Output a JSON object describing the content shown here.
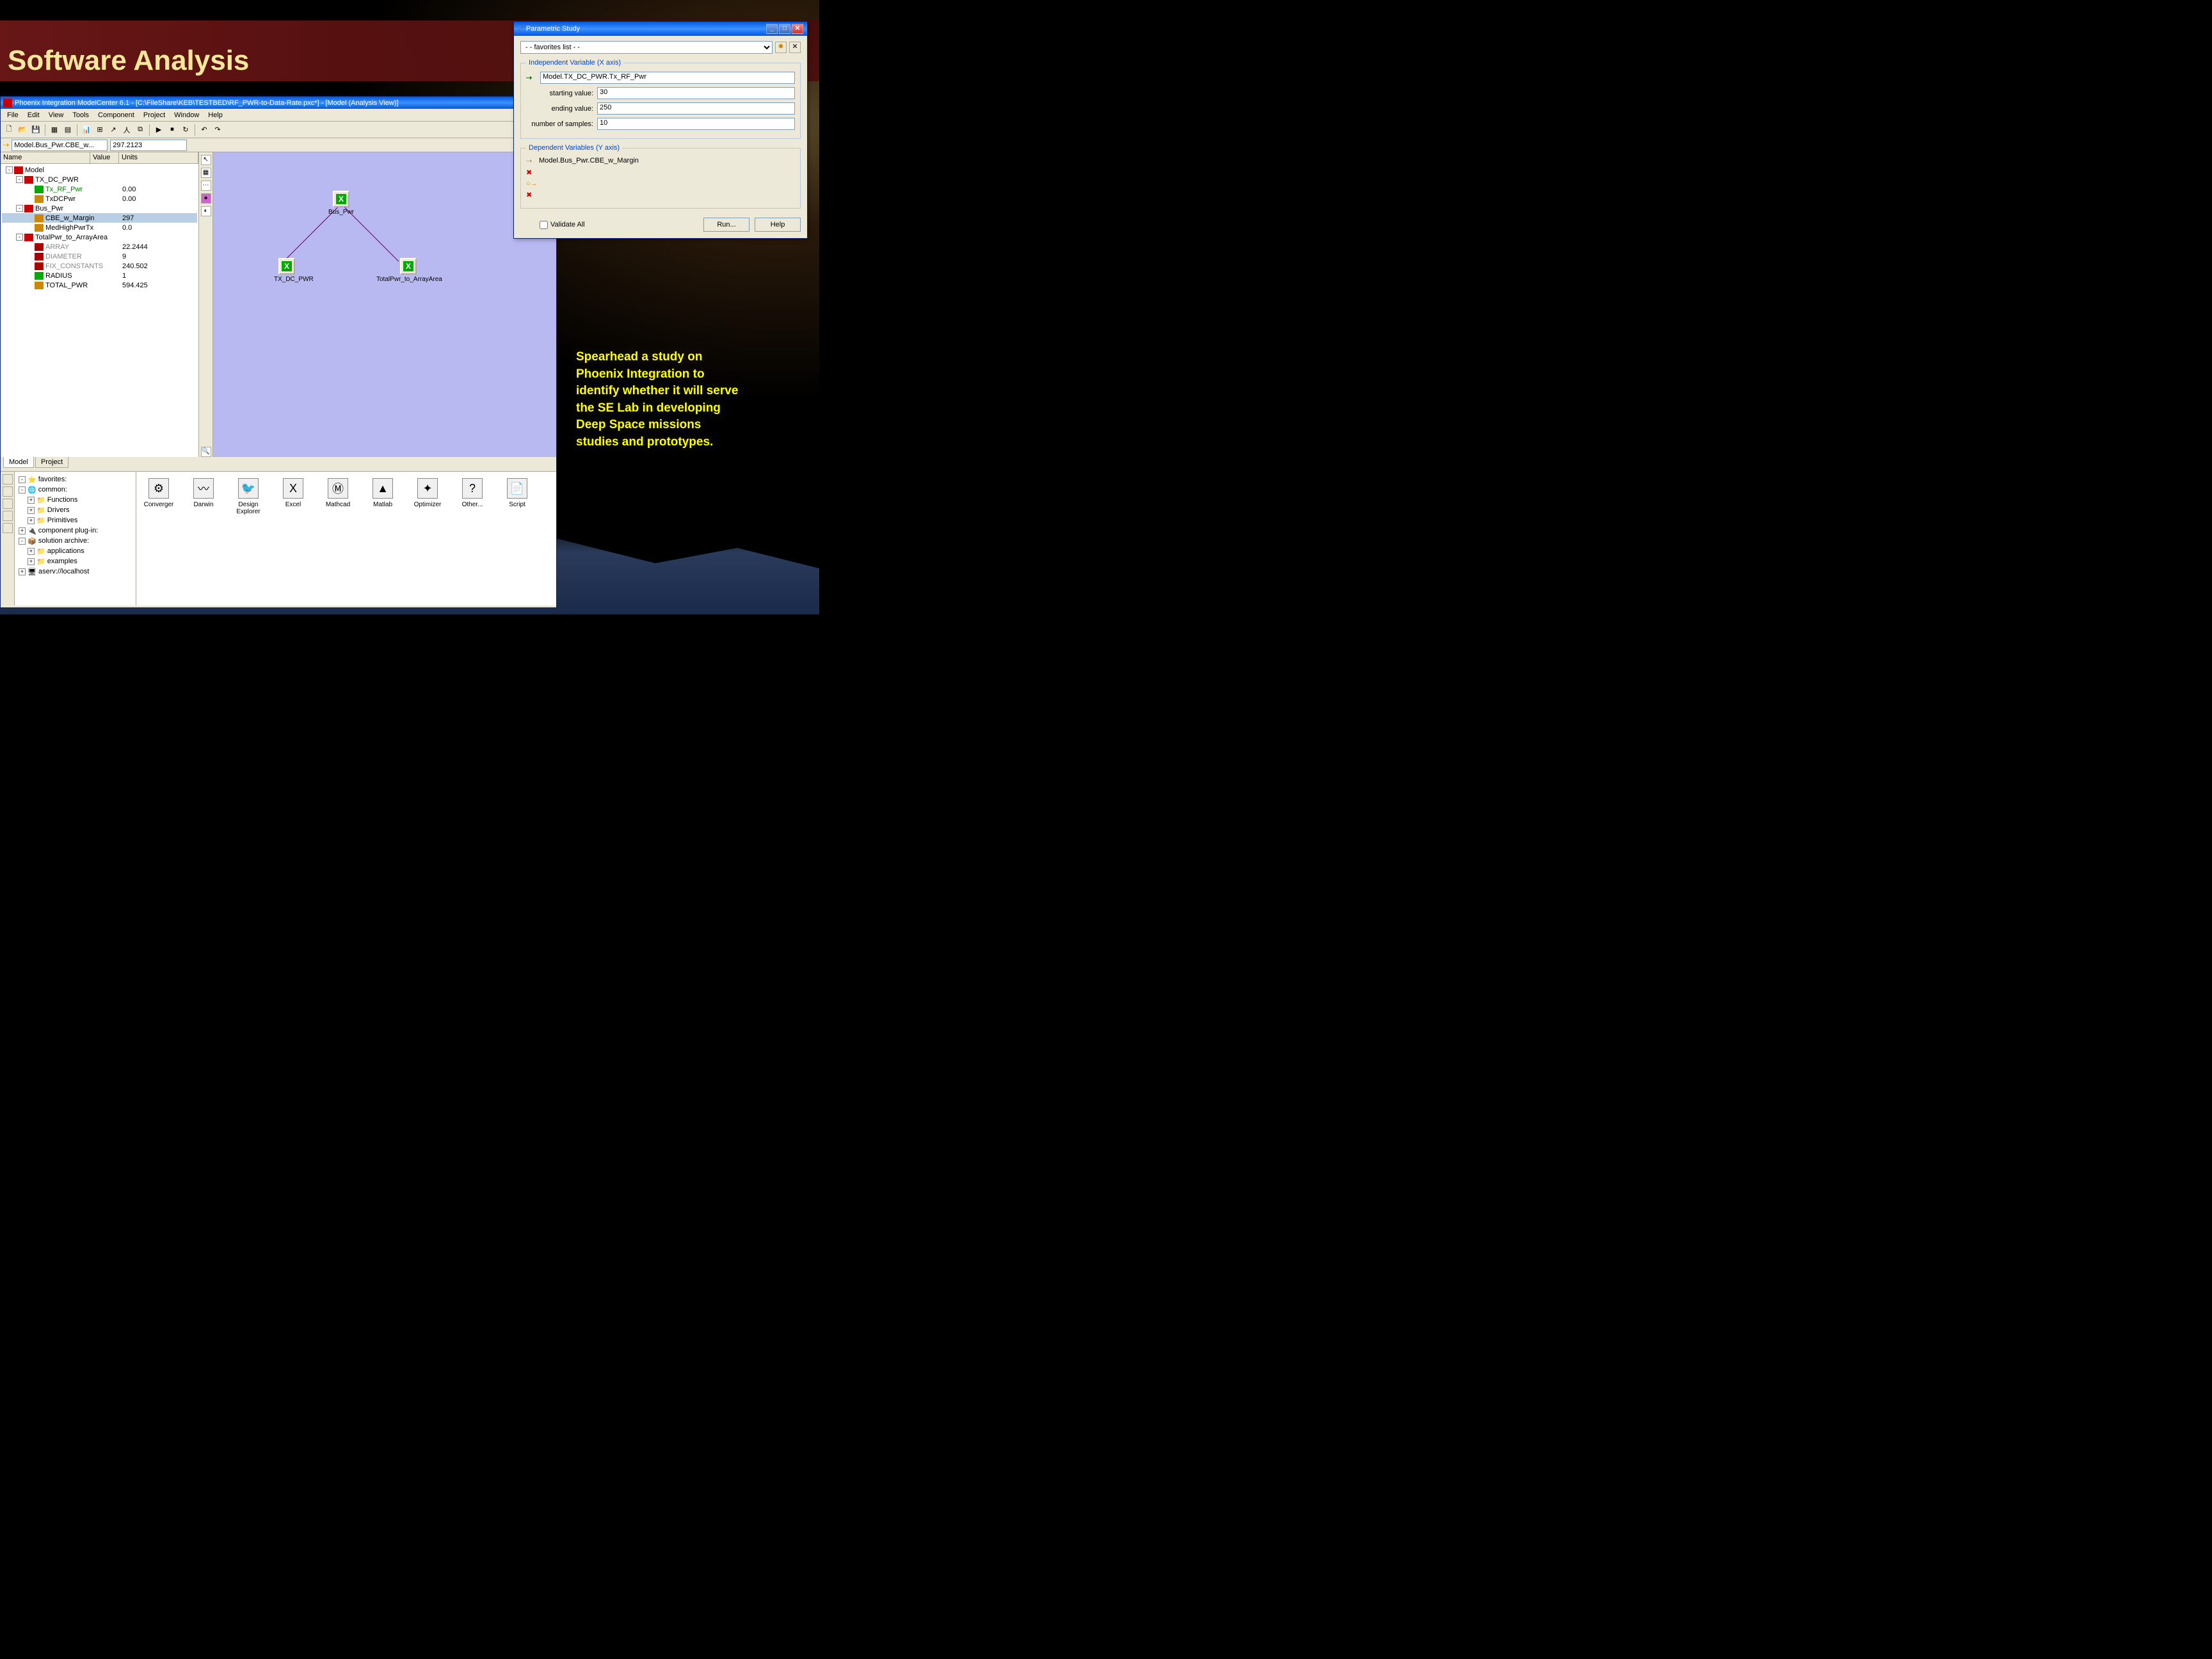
{
  "slide": {
    "title": "Software Analysis",
    "caption": "Spearhead a study on Phoenix Integration to identify whether it will serve the SE Lab in developing Deep Space missions studies and prototypes."
  },
  "mc": {
    "title": "Phoenix Integration ModelCenter 6.1 - [C:\\FileShare\\KEB\\TESTBED\\RF_PWR-to-Data-Rate.pxc*] - [Model (Analysis View)]",
    "menu": [
      "File",
      "Edit",
      "View",
      "Tools",
      "Component",
      "Project",
      "Window",
      "Help"
    ],
    "path_field": "Model.Bus_Pwr.CBE_w...",
    "path_value": "297.2123",
    "tree_headers": {
      "name": "Name",
      "value": "Value",
      "units": "Units"
    },
    "tree": [
      {
        "indent": 0,
        "exp": "-",
        "icon": "#c00",
        "name": "Model",
        "val": ""
      },
      {
        "indent": 1,
        "exp": "-",
        "icon": "#c00",
        "name": "TX_DC_PWR",
        "val": ""
      },
      {
        "indent": 2,
        "exp": "",
        "icon": "#0a0",
        "name": "Tx_RF_Pwr",
        "val": "0.00",
        "cls": "green"
      },
      {
        "indent": 2,
        "exp": "",
        "icon": "#c80",
        "name": "TxDCPwr",
        "val": "0.00"
      },
      {
        "indent": 1,
        "exp": "-",
        "icon": "#c00",
        "name": "Bus_Pwr",
        "val": ""
      },
      {
        "indent": 2,
        "exp": "",
        "icon": "#c80",
        "name": "CBE_w_Margin",
        "val": "297",
        "sel": true
      },
      {
        "indent": 2,
        "exp": "",
        "icon": "#c80",
        "name": "MedHighPwrTx",
        "val": "0.0"
      },
      {
        "indent": 1,
        "exp": "-",
        "icon": "#c00",
        "name": "TotalPwr_to_ArrayArea",
        "val": ""
      },
      {
        "indent": 2,
        "exp": "",
        "icon": "#a00",
        "name": "ARRAY",
        "val": "22.2444",
        "cls": "gray"
      },
      {
        "indent": 2,
        "exp": "",
        "icon": "#a00",
        "name": "DIAMETER",
        "val": "9",
        "cls": "gray"
      },
      {
        "indent": 2,
        "exp": "",
        "icon": "#a00",
        "name": "FIX_CONSTANTS",
        "val": "240.502",
        "cls": "gray"
      },
      {
        "indent": 2,
        "exp": "",
        "icon": "#0a0",
        "name": "RADIUS",
        "val": "1"
      },
      {
        "indent": 2,
        "exp": "",
        "icon": "#c80",
        "name": "TOTAL_PWR",
        "val": "594.425"
      }
    ],
    "tabs": {
      "model": "Model",
      "project": "Project"
    },
    "nodes": {
      "bus": "Bus_Pwr",
      "tx": "TX_DC_PWR",
      "total": "TotalPwr_to_ArrayArea"
    },
    "bottom_tree": [
      {
        "indent": 0,
        "exp": "-",
        "icon": "⭐",
        "name": "favorites:"
      },
      {
        "indent": 0,
        "exp": "-",
        "icon": "🌐",
        "name": "common:"
      },
      {
        "indent": 1,
        "exp": "+",
        "icon": "📁",
        "name": "Functions"
      },
      {
        "indent": 1,
        "exp": "+",
        "icon": "📁",
        "name": "Drivers"
      },
      {
        "indent": 1,
        "exp": "+",
        "icon": "📁",
        "name": "Primitives"
      },
      {
        "indent": 0,
        "exp": "+",
        "icon": "🔌",
        "name": "component plug-in:"
      },
      {
        "indent": 0,
        "exp": "-",
        "icon": "📦",
        "name": "solution archive:"
      },
      {
        "indent": 1,
        "exp": "+",
        "icon": "📁",
        "name": "applications"
      },
      {
        "indent": 1,
        "exp": "+",
        "icon": "📁",
        "name": "examples"
      },
      {
        "indent": 0,
        "exp": "+",
        "icon": "🖥",
        "name": "aserv://localhost"
      }
    ],
    "palette": [
      {
        "label": "Converger",
        "glyph": "⚙"
      },
      {
        "label": "Darwin",
        "glyph": "〰"
      },
      {
        "label": "Design Explorer",
        "glyph": "🐦"
      },
      {
        "label": "Excel",
        "glyph": "X"
      },
      {
        "label": "Mathcad",
        "glyph": "Ⓜ"
      },
      {
        "label": "Matlab",
        "glyph": "▲"
      },
      {
        "label": "Optimizer",
        "glyph": "✦"
      },
      {
        "label": "Other...",
        "glyph": "?"
      },
      {
        "label": "Script",
        "glyph": "📄"
      }
    ]
  },
  "ps": {
    "title": "Parametric Study",
    "favorites_label": "- - favorites list - -",
    "indep_legend": "Independent Variable (X axis)",
    "indep_var": "Model.TX_DC_PWR.Tx_RF_Pwr",
    "start_label": "starting value:",
    "start_val": "30",
    "end_label": "ending value:",
    "end_val": "250",
    "samples_label": "number of samples:",
    "samples_val": "10",
    "dep_legend": "Dependent Variables (Y axis)",
    "dep_var": "Model.Bus_Pwr.CBE_w_Margin",
    "validate": "Validate All",
    "run": "Run...",
    "help": "Help"
  }
}
